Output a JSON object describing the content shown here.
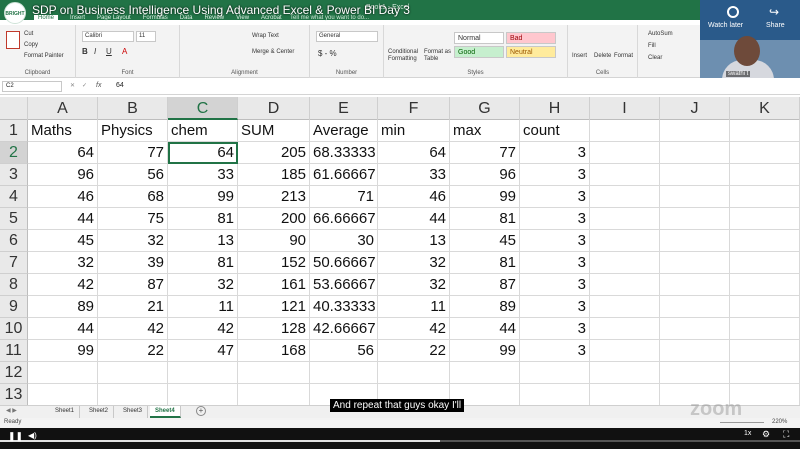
{
  "video": {
    "title": "SDP on Business Intelligence Using Advanced Excel & Power BI Day 3",
    "logo_text": "BRIGHT",
    "watch_later": "Watch later",
    "share": "Share",
    "subtitle": "And repeat that guys okay I'll",
    "watermark": "zoom",
    "speed": "1x",
    "progress_fraction": 0.55
  },
  "presenter": {
    "name": "swathi t"
  },
  "excel": {
    "window_title": "Book1 - Excel",
    "tell_me": "Tell me what you want to do...",
    "ribbon_tabs": [
      "Home",
      "Insert",
      "Page Layout",
      "Formulas",
      "Data",
      "Review",
      "View",
      "Acrobat"
    ],
    "active_tab": "Home",
    "clipboard": {
      "cut": "Cut",
      "copy": "Copy",
      "format_painter": "Format Painter",
      "label": "Clipboard"
    },
    "font": {
      "name": "Calibri",
      "size": "11",
      "label": "Font"
    },
    "alignment": {
      "wrap": "Wrap Text",
      "merge": "Merge & Center",
      "label": "Alignment"
    },
    "number": {
      "format": "General",
      "label": "Number"
    },
    "styles": {
      "conditional": "Conditional Formatting",
      "format_table": "Format as Table",
      "normal": "Normal",
      "bad": "Bad",
      "good": "Good",
      "neutral": "Neutral",
      "label": "Styles"
    },
    "cells_group": {
      "insert": "Insert",
      "delete": "Delete",
      "format": "Format",
      "label": "Cells"
    },
    "editing": {
      "autosum": "AutoSum",
      "fill": "Fill",
      "clear": "Clear"
    },
    "name_box": "C2",
    "formula_value": "64",
    "columns": [
      "A",
      "B",
      "C",
      "D",
      "E",
      "F",
      "G",
      "H",
      "I",
      "J",
      "K"
    ],
    "rows": [
      "1",
      "2",
      "3",
      "4",
      "5",
      "6",
      "7",
      "8",
      "9",
      "10",
      "11",
      "12",
      "13"
    ],
    "headers": [
      "Maths",
      "Physics",
      "chem",
      "SUM",
      "Average",
      "min",
      "max",
      "count"
    ],
    "data": [
      [
        "64",
        "77",
        "64",
        "205",
        "68.33333",
        "64",
        "77",
        "3"
      ],
      [
        "96",
        "56",
        "33",
        "185",
        "61.66667",
        "33",
        "96",
        "3"
      ],
      [
        "46",
        "68",
        "99",
        "213",
        "71",
        "46",
        "99",
        "3"
      ],
      [
        "44",
        "75",
        "81",
        "200",
        "66.66667",
        "44",
        "81",
        "3"
      ],
      [
        "45",
        "32",
        "13",
        "90",
        "30",
        "13",
        "45",
        "3"
      ],
      [
        "32",
        "39",
        "81",
        "152",
        "50.66667",
        "32",
        "81",
        "3"
      ],
      [
        "42",
        "87",
        "32",
        "161",
        "53.66667",
        "32",
        "87",
        "3"
      ],
      [
        "89",
        "21",
        "11",
        "121",
        "40.33333",
        "11",
        "89",
        "3"
      ],
      [
        "44",
        "42",
        "42",
        "128",
        "42.66667",
        "42",
        "44",
        "3"
      ],
      [
        "99",
        "22",
        "47",
        "168",
        "56",
        "22",
        "99",
        "3"
      ]
    ],
    "sheets": [
      "Sheet1",
      "Sheet2",
      "Sheet3",
      "Sheet4"
    ],
    "active_sheet": "Sheet4",
    "status": "Ready",
    "zoom": "220%"
  },
  "colors": {
    "excel_green": "#217346",
    "header_gray": "#e9e9e9"
  }
}
